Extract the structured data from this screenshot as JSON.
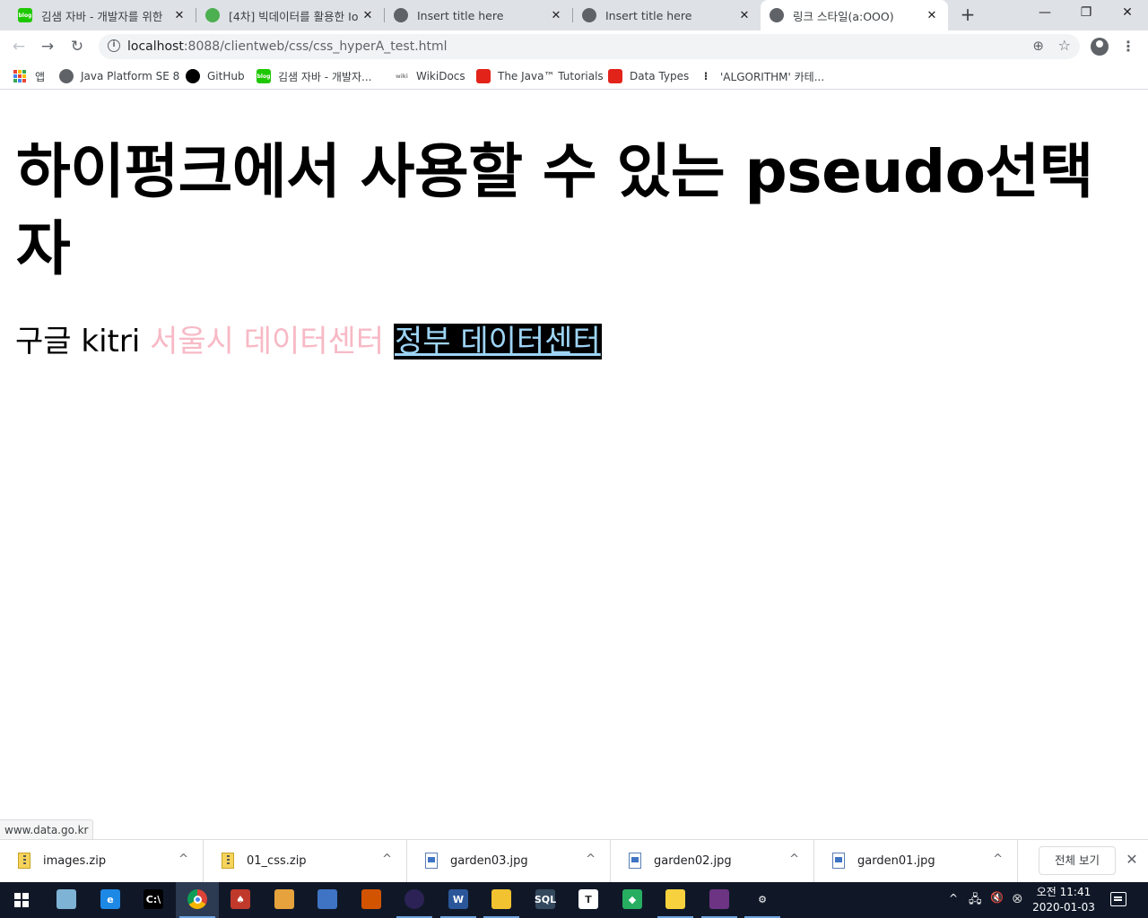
{
  "browser": {
    "tabs": [
      {
        "title": "김샘 자바 - 개발자를 위한",
        "favicon": "blog-icon",
        "favicon_color": "#1ec800",
        "favicon_text": "blog",
        "close": "✕"
      },
      {
        "title": "[4차] 빅데이터를 활용한 Io",
        "favicon": "leaf-icon",
        "favicon_color": "#4caf50",
        "favicon_text": "",
        "close": "✕"
      },
      {
        "title": "Insert title here",
        "favicon": "globe-icon",
        "favicon_color": "#5f6368",
        "favicon_text": "",
        "close": "✕"
      },
      {
        "title": "Insert title here",
        "favicon": "globe-icon",
        "favicon_color": "#5f6368",
        "favicon_text": "",
        "close": "✕"
      },
      {
        "title": "링크 스타일(a:OOO)",
        "favicon": "globe-icon",
        "favicon_color": "#5f6368",
        "favicon_text": "",
        "close": "✕"
      }
    ],
    "new_tab": "+",
    "window_controls": {
      "minimize": "—",
      "restore": "❐",
      "close": "✕"
    },
    "nav": {
      "back": "←",
      "forward": "→",
      "reload": "↻"
    },
    "address": {
      "host": "localhost",
      "path": ":8088/clientweb/css/css_hyperA_test.html"
    },
    "address_icons": {
      "zoom": "⊕",
      "star": "☆"
    },
    "menu": "⋮",
    "bookmarks": [
      {
        "label": "앱",
        "icon": "apps-grid-icon"
      },
      {
        "label": "Java Platform SE 8",
        "icon": "globe-icon",
        "color": "#5f6368"
      },
      {
        "label": "GitHub",
        "icon": "github-icon",
        "color": "#000000"
      },
      {
        "label": "김샘 자바 - 개발자...",
        "icon": "blog-icon",
        "color": "#1ec800",
        "text": "blog"
      },
      {
        "label": "WikiDocs",
        "icon": "wikidocs-icon",
        "color": "#cccccc",
        "text": "wiki"
      },
      {
        "label": "The Java™ Tutorials",
        "icon": "oracle-icon",
        "color": "#e2231a"
      },
      {
        "label": "Data Types",
        "icon": "oracle-icon",
        "color": "#e2231a"
      },
      {
        "label": "'ALGORITHM' 카테...",
        "icon": "tistory-icon",
        "color": "#333333"
      }
    ]
  },
  "page": {
    "heading": "하이펑크에서 사용할 수 있는 pseudo선택자",
    "links": [
      {
        "text": "구글",
        "state": "normal"
      },
      {
        "text": "kitri",
        "state": "normal"
      },
      {
        "text": "서울시 데이터센터",
        "state": "visited"
      },
      {
        "text": "정부 데이터센터",
        "state": "active"
      }
    ],
    "colors": {
      "normal": "#000000",
      "visited": "#f7b9c5",
      "active_text": "#9dd4f5",
      "active_bg": "#000000"
    },
    "status_url": "www.data.go.kr"
  },
  "downloads": {
    "items": [
      {
        "name": "images.zip",
        "type": "zip"
      },
      {
        "name": "01_css.zip",
        "type": "zip"
      },
      {
        "name": "garden03.jpg",
        "type": "image"
      },
      {
        "name": "garden02.jpg",
        "type": "image"
      },
      {
        "name": "garden01.jpg",
        "type": "image"
      }
    ],
    "chevron": "^",
    "show_all": "전체 보기",
    "close": "✕"
  },
  "taskbar": {
    "apps": [
      {
        "name": "windows-mobility-icon",
        "color": "#7fb3d5",
        "glyph": ""
      },
      {
        "name": "internet-explorer-icon",
        "color": "#1e88e5",
        "glyph": "e"
      },
      {
        "name": "command-prompt-icon",
        "color": "#000000",
        "glyph": "C:\\"
      },
      {
        "name": "chrome-icon",
        "color": "#db4437",
        "glyph": "",
        "active": true
      },
      {
        "name": "cards-game-icon",
        "color": "#c0392b",
        "glyph": "♠"
      },
      {
        "name": "paint-icon",
        "color": "#e6a23c",
        "glyph": ""
      },
      {
        "name": "edit-icon",
        "color": "#3f74c4",
        "glyph": ""
      },
      {
        "name": "photo-editor-icon",
        "color": "#d35400",
        "glyph": ""
      },
      {
        "name": "eclipse-icon",
        "color": "#2c2255",
        "glyph": "◐",
        "running": true
      },
      {
        "name": "word-icon",
        "color": "#2b579a",
        "glyph": "W",
        "running": true
      },
      {
        "name": "file-explorer-icon",
        "color": "#f2c230",
        "glyph": "",
        "running": true
      },
      {
        "name": "sql-tool-icon",
        "color": "#34495e",
        "glyph": "SQL"
      },
      {
        "name": "typora-icon",
        "color": "#ffffff",
        "glyph": "T"
      },
      {
        "name": "gem-icon",
        "color": "#27ae60",
        "glyph": "◆"
      },
      {
        "name": "sticky-notes-icon",
        "color": "#f7d23e",
        "glyph": "",
        "running": true
      },
      {
        "name": "game-app-icon",
        "color": "#6c3483",
        "glyph": "",
        "running": true
      },
      {
        "name": "settings-icon",
        "color": "#101828",
        "glyph": "⚙",
        "running": true
      }
    ],
    "tray": {
      "chevron": "^",
      "network": "🖧",
      "volume": "🔇",
      "error": "⊗"
    },
    "clock": {
      "time": "오전 11:41",
      "date": "2020-01-03"
    }
  }
}
